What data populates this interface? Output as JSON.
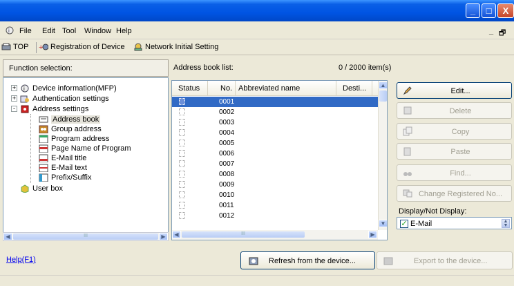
{
  "menu": {
    "items": [
      "File",
      "Edit",
      "Tool",
      "Window",
      "Help"
    ],
    "mdi_controls": "_ &#x1D5D7;"
  },
  "window_controls": {
    "minimize": "_",
    "maximize": "□",
    "close": "X"
  },
  "toolbar": {
    "top_label": "TOP",
    "registration_label": "Registration of Device",
    "network_label": "Network Initial Setting"
  },
  "function_selection": {
    "header": "Function selection:",
    "tree": [
      {
        "label": "Device information(MFP)",
        "level": 0,
        "expander": "+"
      },
      {
        "label": "Authentication settings",
        "level": 0,
        "expander": "+"
      },
      {
        "label": "Address settings",
        "level": 0,
        "expander": "-"
      },
      {
        "label": "Address book",
        "level": 1,
        "selected": true
      },
      {
        "label": "Group address",
        "level": 1
      },
      {
        "label": "Program address",
        "level": 1
      },
      {
        "label": "Page Name of Program",
        "level": 1
      },
      {
        "label": "E-Mail title",
        "level": 1
      },
      {
        "label": "E-Mail text",
        "level": 1
      },
      {
        "label": "Prefix/Suffix",
        "level": 1
      },
      {
        "label": "User box",
        "level": 0
      }
    ],
    "hscroll_grip": "III"
  },
  "address_book": {
    "header": "Address book list:",
    "count": "0 / 2000 item(s)",
    "columns": [
      "Status",
      "No.",
      "Abbreviated name",
      "Desti..."
    ],
    "rows": [
      "0001",
      "0002",
      "0003",
      "0004",
      "0005",
      "0006",
      "0007",
      "0008",
      "0009",
      "0010",
      "0011",
      "0012"
    ],
    "hscroll_grip": "III"
  },
  "actions": {
    "edit": "Edit...",
    "delete": "Delete",
    "copy": "Copy",
    "paste": "Paste",
    "find": "Find...",
    "change_registered": "Change Registered No..."
  },
  "display": {
    "label": "Display/Not Display:",
    "email": "E-Mail",
    "checked": true
  },
  "footer": {
    "help": "Help(F1)",
    "refresh": "Refresh from the device...",
    "export": "Export to the device..."
  }
}
